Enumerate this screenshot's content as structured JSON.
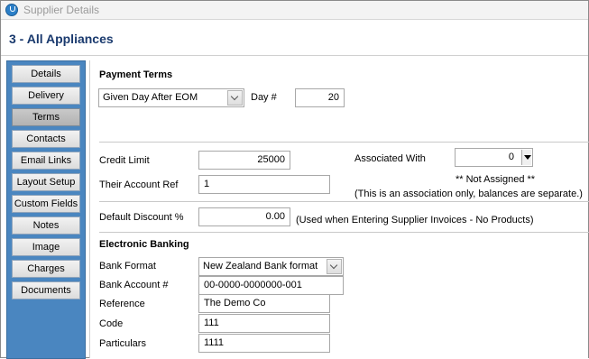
{
  "window": {
    "title": "Supplier Details"
  },
  "header": {
    "title": "3 - All Appliances"
  },
  "sidebar": {
    "items": [
      {
        "label": "Details"
      },
      {
        "label": "Delivery"
      },
      {
        "label": "Terms"
      },
      {
        "label": "Contacts"
      },
      {
        "label": "Email Links"
      },
      {
        "label": "Layout Setup"
      },
      {
        "label": "Custom Fields"
      },
      {
        "label": "Notes"
      },
      {
        "label": "Image"
      },
      {
        "label": "Charges"
      },
      {
        "label": "Documents"
      }
    ],
    "active": "Terms"
  },
  "payment_terms": {
    "section_title": "Payment Terms",
    "terms_type": "Given Day After EOM",
    "day_label": "Day #",
    "day_value": "20"
  },
  "credit": {
    "credit_limit_label": "Credit Limit",
    "credit_limit_value": "25000",
    "their_account_ref_label": "Their Account Ref",
    "their_account_ref_value": "1",
    "associated_with_label": "Associated With",
    "associated_with_value": "0",
    "not_assigned_text": "** Not Assigned **",
    "association_note": "(This is an association only, balances are separate.)"
  },
  "discount": {
    "label": "Default Discount %",
    "value": "0.00",
    "note": "(Used when Entering Supplier Invoices - No Products)"
  },
  "banking": {
    "section_title": "Electronic Banking",
    "bank_format_label": "Bank Format",
    "bank_format_value": "New Zealand Bank format",
    "bank_account_label": "Bank Account #",
    "bank_account_value": "00-0000-0000000-001",
    "reference_label": "Reference",
    "reference_value": "The Demo Co",
    "code_label": "Code",
    "code_value": "111",
    "particulars_label": "Particulars",
    "particulars_value": "1111"
  }
}
